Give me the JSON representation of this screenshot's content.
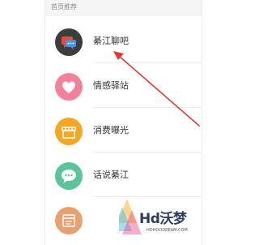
{
  "section": {
    "title": "首页推荐"
  },
  "items": [
    {
      "label": "綦江聊吧",
      "icon": "chat-bubbles-icon",
      "color": "#3d3d3d"
    },
    {
      "label": "情感驿站",
      "icon": "heart-icon",
      "color": "#f0839a"
    },
    {
      "label": "消费曝光",
      "icon": "store-icon",
      "color": "#f5a623"
    },
    {
      "label": "话说綦江",
      "icon": "speech-bubble-icon",
      "color": "#5bc49b"
    },
    {
      "label": "",
      "icon": "browser-window-icon",
      "color": "#e8a06e"
    }
  ],
  "annotation": {
    "arrow_color": "#e0393a"
  },
  "watermark": {
    "text": "Hd沃梦",
    "subtext": "HDHOODREAM.COM"
  }
}
